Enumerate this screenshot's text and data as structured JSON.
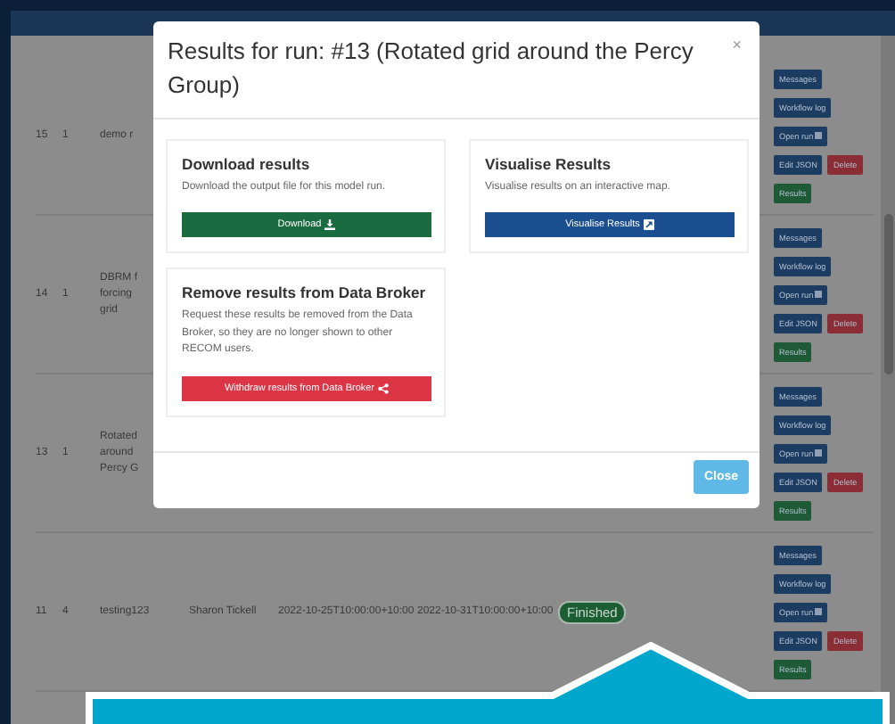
{
  "runs": [
    {
      "id": "15",
      "version": "1",
      "name_lines": [
        "demo r"
      ],
      "actions": [
        [
          {
            "label": "Messages",
            "kind": "primary"
          }
        ],
        [
          {
            "label": "Workflow log",
            "kind": "primary"
          }
        ],
        [
          {
            "label": "Open run",
            "kind": "external"
          }
        ],
        [
          {
            "label": "Edit JSON",
            "kind": "primary"
          },
          {
            "label": "Delete",
            "kind": "danger"
          }
        ],
        [
          {
            "label": "Results",
            "kind": "success"
          }
        ]
      ]
    },
    {
      "id": "14",
      "version": "1",
      "name_lines": [
        "DBRM f",
        "forcing",
        "grid"
      ],
      "actions": [
        [
          {
            "label": "Messages",
            "kind": "primary"
          }
        ],
        [
          {
            "label": "Workflow log",
            "kind": "primary"
          }
        ],
        [
          {
            "label": "Open run",
            "kind": "external"
          }
        ],
        [
          {
            "label": "Edit JSON",
            "kind": "primary"
          },
          {
            "label": "Delete",
            "kind": "danger"
          }
        ],
        [
          {
            "label": "Results",
            "kind": "success"
          }
        ]
      ]
    },
    {
      "id": "13",
      "version": "1",
      "name_lines": [
        "Rotated",
        "around",
        "Percy G"
      ],
      "actions": [
        [
          {
            "label": "Messages",
            "kind": "primary"
          }
        ],
        [
          {
            "label": "Workflow log",
            "kind": "primary"
          }
        ],
        [
          {
            "label": "Open run",
            "kind": "external"
          }
        ],
        [
          {
            "label": "Edit JSON",
            "kind": "primary"
          },
          {
            "label": "Delete",
            "kind": "danger"
          }
        ],
        [
          {
            "label": "Results",
            "kind": "success"
          }
        ]
      ]
    },
    {
      "id": "11",
      "version": "4",
      "name_lines": [
        "testing123"
      ],
      "user": "Sharon Tickell",
      "start": "2022-10-25T10:00:00+10:00",
      "end": "2022-10-31T10:00:00+10:00",
      "status": "Finished",
      "actions": [
        [
          {
            "label": "Messages",
            "kind": "primary"
          }
        ],
        [
          {
            "label": "Workflow log",
            "kind": "primary"
          }
        ],
        [
          {
            "label": "Open run",
            "kind": "external"
          }
        ],
        [
          {
            "label": "Edit JSON",
            "kind": "primary"
          },
          {
            "label": "Delete",
            "kind": "danger"
          }
        ],
        [
          {
            "label": "Results",
            "kind": "success"
          }
        ]
      ]
    }
  ],
  "modal": {
    "title": "Results for run: #13 (Rotated grid around the Percy Group)",
    "close": "×",
    "cards": [
      {
        "heading": "Download results",
        "text": "Download the output file for this model run.",
        "button": {
          "label": "Download",
          "kind": "success"
        }
      },
      {
        "heading": "Visualise Results",
        "text": "Visualise results on an interactive map.",
        "button": {
          "label": "Visualise Results",
          "kind": "primary"
        }
      },
      {
        "heading": "Remove results from Data Broker",
        "text": "Request these results be removed from the Data Broker, so they are no longer shown to other RECOM users.",
        "button": {
          "label": "Withdraw results from Data Broker",
          "kind": "danger"
        }
      }
    ],
    "footer_button": "Close"
  }
}
